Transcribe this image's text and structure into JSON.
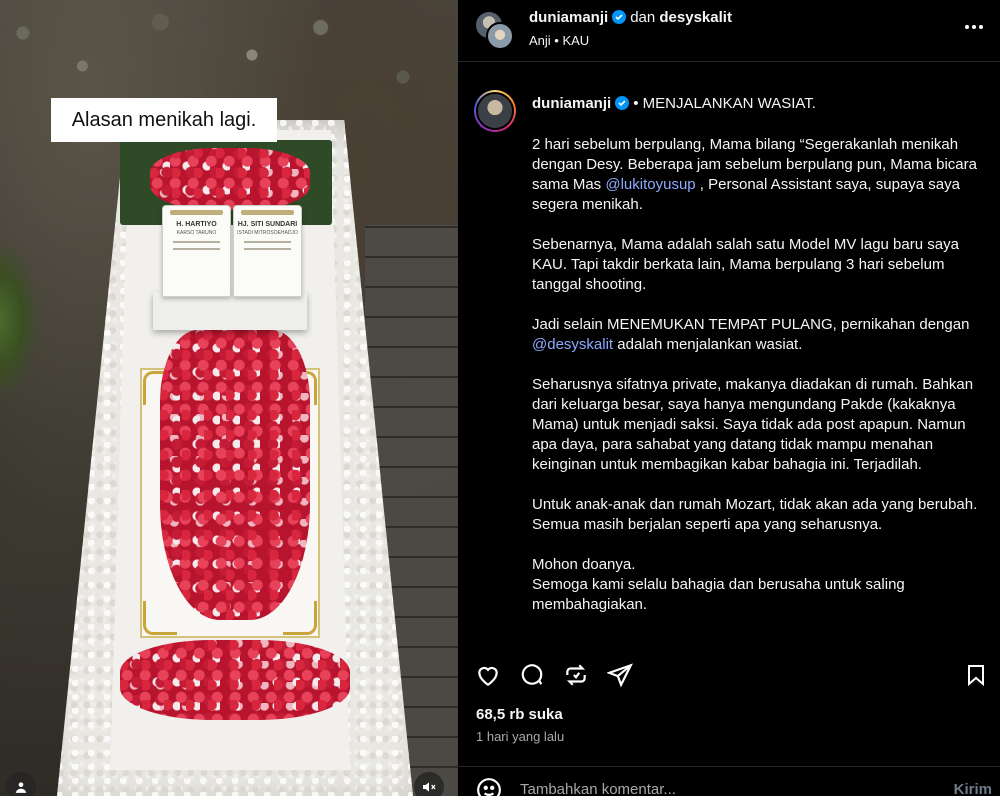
{
  "media": {
    "caption_overlay": "Alasan menikah lagi.",
    "tombstone": {
      "left_name": "H. HARTIYO",
      "left_parent": "KARSO TARUNO",
      "right_name": "HJ. SITI SUNDARI",
      "right_parent": "ISTADI MITROSOEHADJO"
    },
    "user_icon": "user-tag-icon",
    "mute_icon": "speaker-muted-icon"
  },
  "header": {
    "user1": "duniamanji",
    "conjunction": "dan",
    "user2": "desyskalit",
    "subtitle": "Anji • KAU",
    "more_icon": "more-horizontal-icon"
  },
  "caption": {
    "username": "duniamanji",
    "headline": "• MENJALANKAN WASIAT.",
    "paragraphs": [
      {
        "before": "2 hari sebelum berpulang, Mama bilang “Segerakanlah menikah dengan Desy. Beberapa jam sebelum berpulang pun, Mama bicara sama Mas ",
        "mention": "@lukitoyusup",
        "after": " , Personal Assistant saya, supaya saya segera menikah."
      },
      {
        "before": "Sebenarnya, Mama adalah salah satu Model MV lagu baru saya KAU. Tapi takdir berkata lain, Mama berpulang 3 hari sebelum tanggal shooting.",
        "mention": "",
        "after": ""
      },
      {
        "before": "Jadi selain MENEMUKAN TEMPAT PULANG, pernikahan dengan ",
        "mention": "@desyskalit",
        "after": " adalah menjalankan wasiat."
      },
      {
        "before": "Seharusnya sifatnya private, makanya diadakan di rumah. Bahkan dari keluarga besar, saya hanya mengundang Pakde (kakaknya Mama) untuk menjadi saksi. Saya tidak ada post apapun. Namun apa daya, para sahabat yang datang tidak mampu menahan keinginan untuk membagikan kabar bahagia ini. Terjadilah.",
        "mention": "",
        "after": ""
      },
      {
        "before": "Untuk anak-anak dan rumah Mozart, tidak akan ada yang berubah.\nSemua masih berjalan seperti apa yang seharusnya.",
        "mention": "",
        "after": ""
      },
      {
        "before": "Mohon doanya.\nSemoga kami selalu bahagia dan berusaha untuk saling membahagiakan.",
        "mention": "",
        "after": ""
      }
    ]
  },
  "actions": {
    "icons": [
      "heart-icon",
      "comment-icon",
      "repost-icon",
      "share-icon",
      "bookmark-icon"
    ],
    "likes": "68,5 rb suka",
    "time": "1 hari yang lalu"
  },
  "comment": {
    "emoji_icon": "emoji-icon",
    "placeholder": "Tambahkan komentar...",
    "send_label": "Kirim"
  },
  "colors": {
    "verified": "#0095f6",
    "mention": "#8fa9ff",
    "background": "#000000"
  }
}
